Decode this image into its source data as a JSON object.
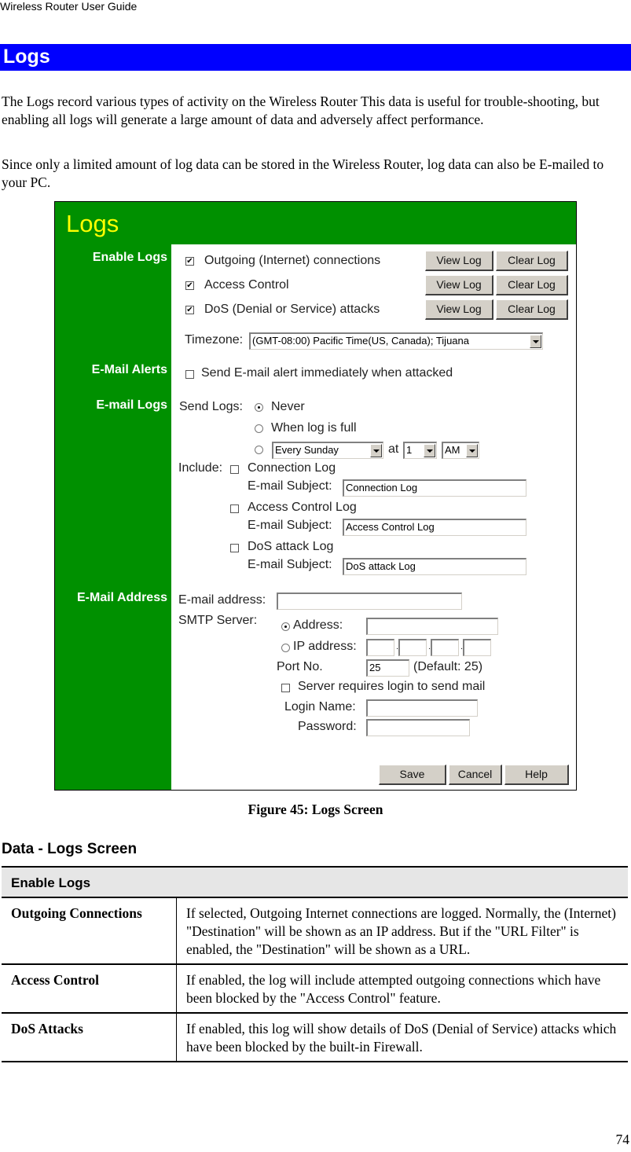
{
  "doc": {
    "running_header": "Wireless Router User Guide",
    "section_title": "Logs",
    "intro_paragraphs": [
      "The Logs record various types of activity on the Wireless Router This data is useful for trouble-shooting, but enabling all logs will generate a large amount of data and adversely affect performance.",
      "Since only a limited amount of log data can be stored in the Wireless Router, log data can also be E-mailed to your PC."
    ],
    "figure_caption": "Figure 45: Logs Screen",
    "data_heading": "Data - Logs Screen",
    "page_number": "74"
  },
  "screen": {
    "title": "Logs",
    "colors": {
      "sidebar": "#009000",
      "title": "#ffff00",
      "banner": "#0000ff"
    },
    "sections": {
      "enable_logs": "Enable Logs",
      "email_alerts": "E-Mail Alerts",
      "email_logs": "E-mail Logs",
      "email_address": "E-Mail Address"
    },
    "enable_logs": [
      {
        "label": "Outgoing (Internet) connections",
        "checked": true,
        "view": "View Log",
        "clear": "Clear Log"
      },
      {
        "label": "Access Control",
        "checked": true,
        "view": "View Log",
        "clear": "Clear Log"
      },
      {
        "label": "DoS (Denial or Service) attacks",
        "checked": true,
        "view": "View Log",
        "clear": "Clear Log"
      }
    ],
    "timezone_label": "Timezone:",
    "timezone_value": "(GMT-08:00) Pacific Time(US, Canada); Tijuana",
    "alert_label": "Send E-mail alert immediately when attacked",
    "send_logs_label": "Send Logs:",
    "send_options": [
      "Never",
      "When log is full"
    ],
    "schedule_day": "Every Sunday",
    "at_label": "at",
    "schedule_hour": "1",
    "schedule_ampm": "AM",
    "include_label": "Include:",
    "includes": [
      {
        "label": "Connection Log",
        "subject_label": "E-mail Subject:",
        "subject": "Connection Log"
      },
      {
        "label": "Access Control Log",
        "subject_label": "E-mail Subject:",
        "subject": "Access Control Log"
      },
      {
        "label": "DoS attack Log",
        "subject_label": "E-mail Subject:",
        "subject": "DoS attack Log"
      }
    ],
    "email_address_label": "E-mail address:",
    "email_address_value": "",
    "smtp_label": "SMTP Server:",
    "smtp_address_label": "Address:",
    "smtp_ip_label": "IP address:",
    "port_label": "Port No.",
    "port_value": "25",
    "port_default": "(Default: 25)",
    "login_required_label": "Server requires login to send mail",
    "login_name_label": "Login Name:",
    "password_label": "Password:",
    "buttons": {
      "save": "Save",
      "cancel": "Cancel",
      "help": "Help"
    }
  },
  "table": {
    "section": "Enable Logs",
    "rows": [
      {
        "key": "Outgoing Connections",
        "value": "If selected, Outgoing Internet connections are logged. Normally, the (Internet) \"Destination\" will be shown as an IP address. But if the \"URL Filter\" is enabled, the \"Destination\" will be shown as a URL."
      },
      {
        "key": "Access Control",
        "value": "If enabled, the log will include attempted outgoing connections which have been blocked by the \"Access Control\" feature."
      },
      {
        "key": "DoS Attacks",
        "value": "If enabled, this log will show details of DoS (Denial of Service) attacks which have been blocked by the built-in Firewall."
      }
    ]
  }
}
